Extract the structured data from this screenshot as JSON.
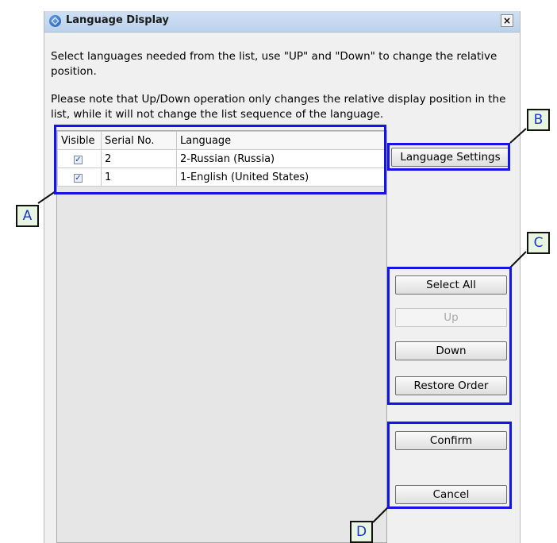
{
  "window": {
    "title": "Language Display",
    "close_label": "×",
    "description_1": "Select languages needed from the list, use \"UP\" and \"Down\" to change the relative position.",
    "description_2": "Please note that Up/Down operation only changes the relative display position in the list, while it will not change the list sequence of the language."
  },
  "table": {
    "headers": [
      "Visible",
      "Serial No.",
      "Language"
    ],
    "rows": [
      {
        "visible": true,
        "serial": "2",
        "language": "2-Russian (Russia)"
      },
      {
        "visible": true,
        "serial": "1",
        "language": "1-English (United States)"
      }
    ]
  },
  "buttons": {
    "language_settings": "Language Settings",
    "select_all": "Select All",
    "up": "Up",
    "down": "Down",
    "restore_order": "Restore Order",
    "confirm": "Confirm",
    "cancel": "Cancel"
  },
  "callouts": {
    "a": "A",
    "b": "B",
    "c": "C",
    "d": "D"
  },
  "colors": {
    "highlight": "#1414e6",
    "callout_fill": "#e8f5e1",
    "callout_text": "#1d34d9"
  }
}
